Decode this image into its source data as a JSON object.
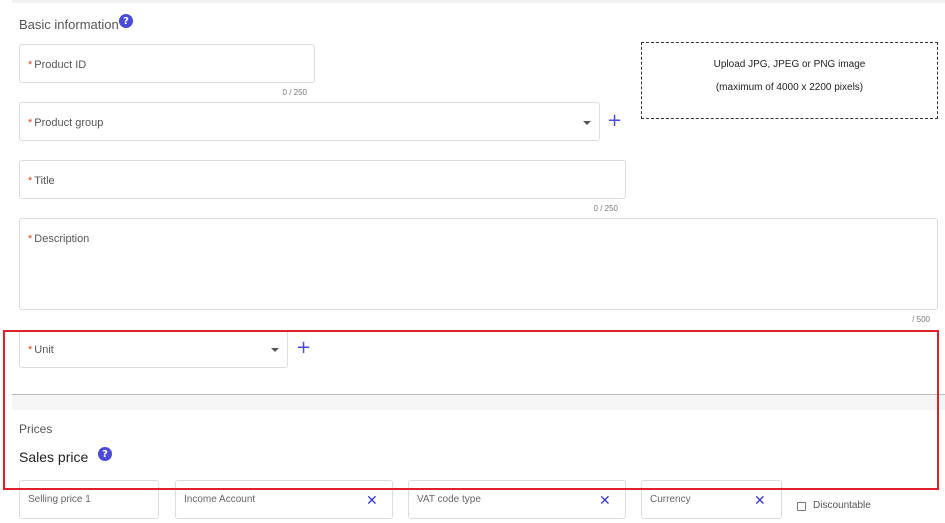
{
  "basic_info": {
    "title": "Basic information",
    "help_glyph": "?",
    "product_id": {
      "required_mark": "*",
      "label": "Product ID",
      "counter": "0 / 250"
    },
    "product_group": {
      "required_mark": "*",
      "label": "Product group",
      "add_glyph": "+"
    },
    "title_field": {
      "required_mark": "*",
      "label": "Title",
      "counter": "0 / 250"
    },
    "description": {
      "required_mark": "*",
      "label": "Description",
      "counter": "/ 500"
    },
    "unit": {
      "required_mark": "*",
      "label": "Unit",
      "add_glyph": "+"
    },
    "upload": {
      "line1": "Upload JPG, JPEG or PNG image",
      "line2": "(maximum of 4000 x 2200 pixels)"
    }
  },
  "prices": {
    "title": "Prices",
    "sales_price_title": "Sales price",
    "help_glyph": "?",
    "selling_price_label": "Selling price 1",
    "income_account_label": "Income Account",
    "vat_code_label": "VAT code type",
    "currency_label": "Currency",
    "clear_glyph": "✕",
    "discountable_label": "Discountable"
  },
  "colors": {
    "accent": "#4a4adb",
    "required": "#e0452b",
    "highlight": "#e0202a"
  },
  "icons": [
    "help-icon",
    "chevron-down-icon",
    "plus-icon",
    "close-icon",
    "checkbox-icon"
  ]
}
